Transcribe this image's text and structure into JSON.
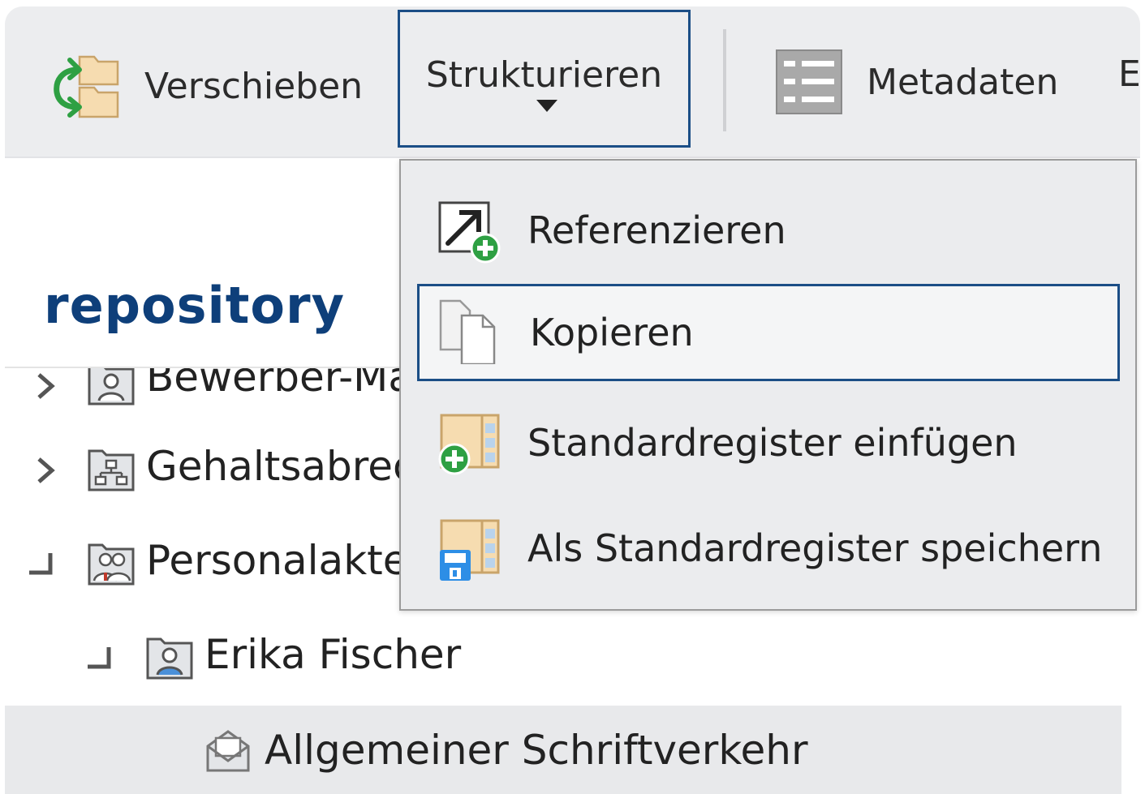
{
  "toolbar": {
    "move_label": "Verschieben",
    "structure_label": "Strukturieren",
    "metadata_label": "Metadaten",
    "more_label": "E"
  },
  "logo": {
    "text": "repository"
  },
  "dropdown": {
    "items": [
      {
        "label": "Referenzieren",
        "icon": "reference-add-icon"
      },
      {
        "label": "Kopieren",
        "icon": "copy-icon"
      },
      {
        "label": "Standardregister einfügen",
        "icon": "register-add-icon"
      },
      {
        "label": "Als Standardregister speichern",
        "icon": "register-save-icon"
      }
    ],
    "active_index": 1
  },
  "tree": {
    "items": [
      {
        "label": "Bewerber-Ma",
        "icon": "person-folder-icon",
        "expander": "chevron-right"
      },
      {
        "label": "Gehaltsabrec",
        "icon": "org-folder-icon",
        "expander": "chevron-right"
      },
      {
        "label": "Personalakte",
        "icon": "people-folder-icon",
        "expander": "branch-end"
      },
      {
        "label": "Erika Fischer",
        "icon": "person-folder-icon",
        "expander": "branch-end"
      },
      {
        "label": "Allgemeiner Schriftverkehr",
        "icon": "envelope-icon",
        "expander": "none"
      }
    ],
    "selected_index": 4
  },
  "colors": {
    "accent": "#1b4e86",
    "logo": "#0e3f7a",
    "toolbar_bg": "#ecedef",
    "menu_bg": "#ebecee",
    "green": "#2ea043",
    "folder": "#f6dcb0"
  }
}
